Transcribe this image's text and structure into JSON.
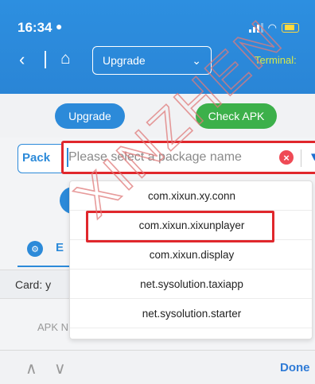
{
  "status_bar": {
    "time": "16:34",
    "person_glyph": "●"
  },
  "nav": {
    "back_glyph": "‹",
    "home_glyph": "⌂",
    "select_value": "Upgrade",
    "chevron": "⌄",
    "terminal_label": "Terminal: "
  },
  "buttons": {
    "upgrade": "Upgrade",
    "check_apk": "Check APK"
  },
  "package": {
    "label": "Pack",
    "placeholder": "Please select a package name",
    "clear_glyph": "×",
    "dropdown_glyph": "▼"
  },
  "background": {
    "tab_letter": "E",
    "card_label": "Card: y",
    "apk_label": "APK N"
  },
  "dropdown_options": [
    "com.xixun.xy.conn",
    "com.xixun.xixunplayer",
    "com.xixun.display",
    "net.sysolution.taxiapp",
    "net.sysolution.starter"
  ],
  "keyboard_bar": {
    "up": "∧",
    "down": "∨",
    "done": "Done"
  },
  "watermark": {
    "text": "XINZHEN"
  },
  "colors": {
    "primary": "#2c8ad9",
    "green": "#3cb04a",
    "highlight": "#e0272c"
  }
}
